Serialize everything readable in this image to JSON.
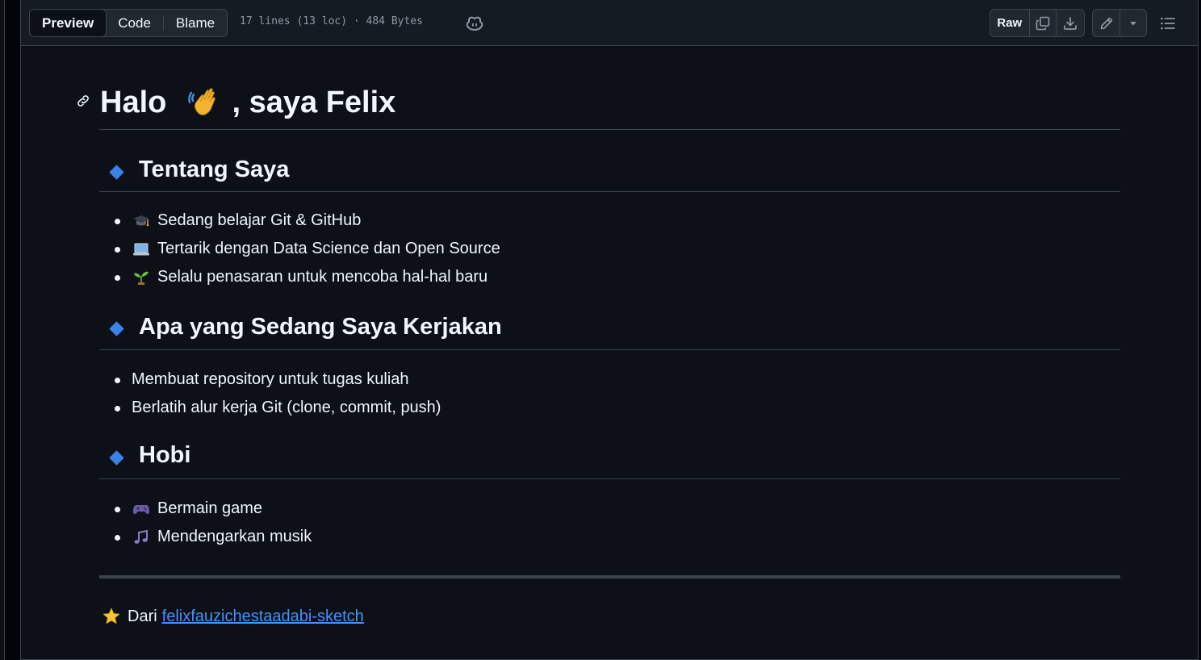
{
  "toolbar": {
    "tabs": [
      "Preview",
      "Code",
      "Blame"
    ],
    "active_tab": "Preview",
    "file_info": "17 lines (13 loc) · 484 Bytes",
    "raw_label": "Raw"
  },
  "readme": {
    "title_prefix": "Halo",
    "title_suffix": ", saya Felix",
    "sections": [
      {
        "heading": "Tentang Saya",
        "items": [
          {
            "icon": "graduation-cap-icon",
            "text": "Sedang belajar Git & GitHub"
          },
          {
            "icon": "laptop-icon",
            "text": "Tertarik dengan Data Science dan Open Source"
          },
          {
            "icon": "seedling-icon",
            "text": "Selalu penasaran untuk mencoba hal-hal baru"
          }
        ]
      },
      {
        "heading": "Apa yang Sedang Saya Kerjakan",
        "items": [
          {
            "text": "Membuat repository untuk tugas kuliah"
          },
          {
            "text": "Berlatih alur kerja Git (clone, commit, push)"
          }
        ]
      },
      {
        "heading": "Hobi",
        "items": [
          {
            "icon": "game-controller-icon",
            "text": "Bermain game"
          },
          {
            "icon": "music-note-icon",
            "text": "Mendengarkan musik"
          }
        ]
      }
    ],
    "footer_text": "Dari",
    "footer_link": "felixfauzichestaadabi-sketch"
  },
  "colors": {
    "background": "#0d1117",
    "toolbar": "#151b23",
    "border": "#3d444d",
    "text": "#f0f6fc",
    "muted": "#9198a1",
    "link": "#4493f8",
    "diamond": "#3b82e8"
  }
}
